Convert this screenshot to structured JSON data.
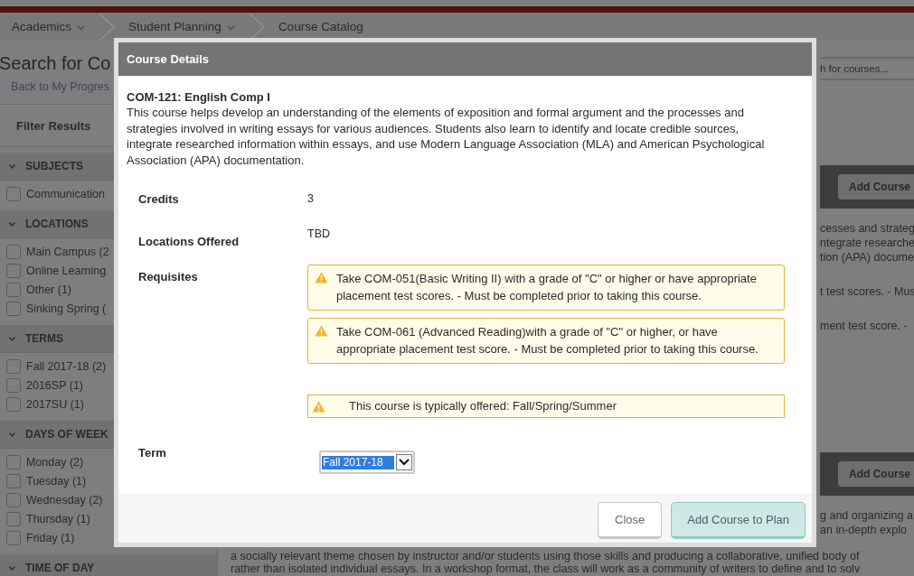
{
  "breadcrumbs": [
    {
      "label": "Academics",
      "dropdown": true
    },
    {
      "label": "Student Planning",
      "dropdown": true
    },
    {
      "label": "Course Catalog",
      "dropdown": false
    }
  ],
  "page": {
    "title": "Search for Co",
    "back_link": "Back to My Progres"
  },
  "filters": {
    "title": "Filter Results",
    "sections": [
      {
        "title": "SUBJECTS",
        "expanded": true,
        "items": [
          {
            "label": "Communication",
            "checked": false
          }
        ]
      },
      {
        "title": "LOCATIONS",
        "expanded": true,
        "items": [
          {
            "label": "Main Campus (2",
            "checked": false
          },
          {
            "label": "Online Learning",
            "checked": false
          },
          {
            "label": "Other (1)",
            "checked": false
          },
          {
            "label": "Sinking Spring (",
            "checked": false
          }
        ]
      },
      {
        "title": "TERMS",
        "expanded": true,
        "items": [
          {
            "label": "Fall 2017-18 (2)",
            "checked": false
          },
          {
            "label": "2016SP (1)",
            "checked": false
          },
          {
            "label": "2017SU (1)",
            "checked": false
          }
        ]
      },
      {
        "title": "DAYS OF WEEK",
        "expanded": true,
        "items": [
          {
            "label": "Monday (2)",
            "checked": false
          },
          {
            "label": "Tuesday (1)",
            "checked": false
          },
          {
            "label": "Wednesday (2)",
            "checked": false
          },
          {
            "label": "Thursday (1)",
            "checked": false
          },
          {
            "label": "Friday (1)",
            "checked": false
          }
        ]
      },
      {
        "title": "TIME OF DAY",
        "expanded": true
      }
    ]
  },
  "search": {
    "placeholder": "h for courses..."
  },
  "results": [
    {
      "kind": "bar",
      "button": "Add Course"
    },
    {
      "kind": "para",
      "lines": [
        "cesses and strateg",
        "ntegrate researche",
        "tion (APA) docume"
      ]
    },
    {
      "kind": "para",
      "lines": [
        "t test scores. - Mus"
      ]
    },
    {
      "kind": "para",
      "lines": [
        "ment test score. -"
      ]
    },
    {
      "kind": "bar",
      "button": "Add Course"
    },
    {
      "kind": "para",
      "lines": [
        "g and organizing a",
        "an in-depth explo"
      ]
    }
  ],
  "bottom_lines": [
    "a socially relevant theme chosen by instructor and/or students using those skills and producing a collaborative, unified body of",
    "rather than isolated individual essays. In a workshop format, the class will work as a community of writers to define and to solv"
  ],
  "modal": {
    "title": "Course Details",
    "course_title": "COM-121: English Comp I",
    "description": "This course helps develop an understanding of the elements of exposition and formal argument and the processes and strategies involved in writing essays for various audiences. Students also learn to identify and locate credible sources, integrate researched information within essays, and use Modern Language Association (MLA) and American Psychological Association (APA) documentation.",
    "details": [
      {
        "label": "Credits",
        "kind": "text",
        "value": "3"
      },
      {
        "label": "Locations Offered",
        "kind": "text",
        "value": "TBD"
      },
      {
        "label": "Requisites",
        "kind": "warnings",
        "items": [
          "Take COM-051(Basic Writing II) with a grade of \"C\" or higher or have appropriate placement test scores. - Must be completed prior to taking this course.",
          "Take COM-061 (Advanced Reading)with a grade of \"C\" or higher, or have appropriate placement test score. - Must be completed prior to taking this course."
        ]
      }
    ],
    "offered_note": "This course is typically offered: Fall/Spring/Summer",
    "term": {
      "label": "Term",
      "value": "Fall 2017-18"
    },
    "buttons": [
      {
        "label": "Close",
        "kind": "secondary"
      },
      {
        "label": "Add Course to Plan",
        "kind": "primary"
      }
    ]
  }
}
